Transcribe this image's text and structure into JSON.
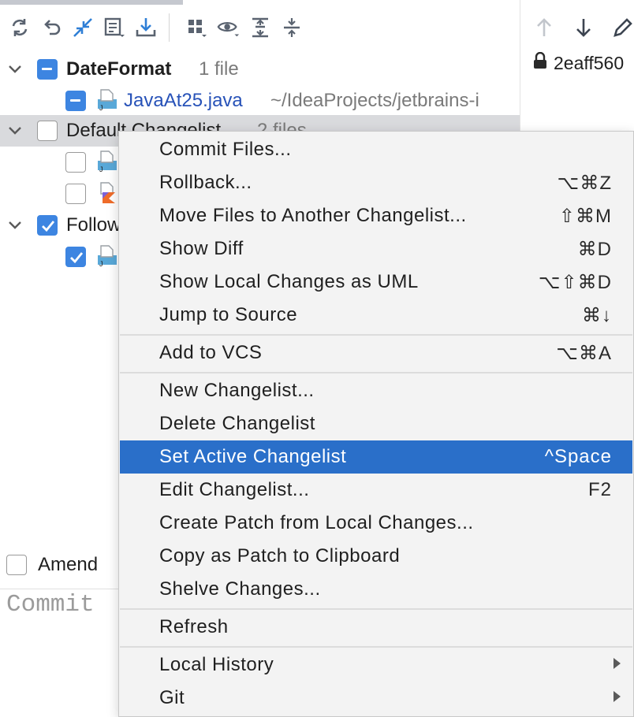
{
  "right_panel": {
    "commit_hash": "2eaff560"
  },
  "tree": {
    "group1": {
      "name": "DateFormat",
      "count": "1 file"
    },
    "group1_file": {
      "name": "JavaAt25.java",
      "path": "~/IdeaProjects/jetbrains-i"
    },
    "group2": {
      "name": "Default Changelist",
      "count": "2 files"
    },
    "group3": {
      "name": "Follow"
    }
  },
  "commit": {
    "amend_label": "Amend",
    "placeholder": "Commit"
  },
  "menu": {
    "items": [
      {
        "label": "Commit Files...",
        "shortcut": ""
      },
      {
        "label": "Rollback...",
        "shortcut": "⌥⌘Z"
      },
      {
        "label": "Move Files to Another Changelist...",
        "shortcut": "⇧⌘M"
      },
      {
        "label": "Show Diff",
        "shortcut": "⌘D"
      },
      {
        "label": "Show Local Changes as UML",
        "shortcut": "⌥⇧⌘D"
      },
      {
        "label": "Jump to Source",
        "shortcut": "⌘↓"
      },
      {
        "label": "Add to VCS",
        "shortcut": "⌥⌘A"
      },
      {
        "label": "New Changelist...",
        "shortcut": ""
      },
      {
        "label": "Delete Changelist",
        "shortcut": ""
      },
      {
        "label": "Set Active Changelist",
        "shortcut": "^Space"
      },
      {
        "label": "Edit Changelist...",
        "shortcut": "F2"
      },
      {
        "label": "Create Patch from Local Changes...",
        "shortcut": ""
      },
      {
        "label": "Copy as Patch to Clipboard",
        "shortcut": ""
      },
      {
        "label": "Shelve Changes...",
        "shortcut": ""
      },
      {
        "label": "Refresh",
        "shortcut": ""
      },
      {
        "label": "Local History",
        "shortcut": ""
      },
      {
        "label": "Git",
        "shortcut": ""
      }
    ]
  },
  "colors": {
    "accent_blue": "#3d85e1",
    "menu_highlight": "#2a6fc9",
    "link_blue": "#2752b8"
  }
}
